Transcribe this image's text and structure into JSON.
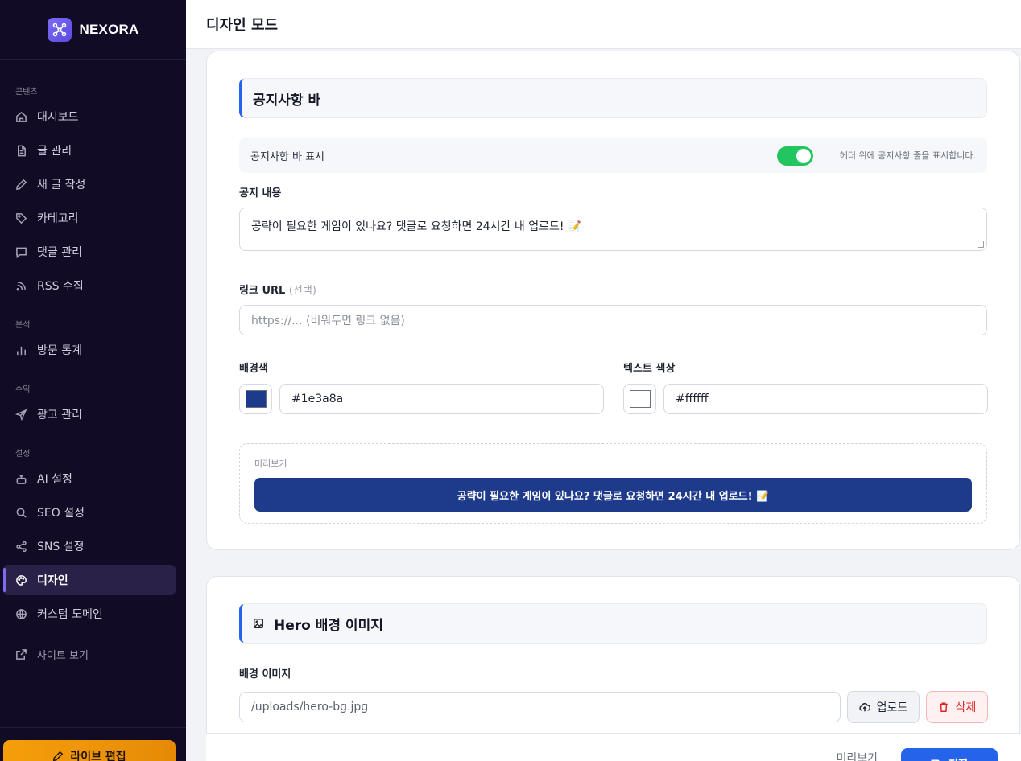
{
  "brand": {
    "name": "NEXORA",
    "logo_icon": "network-icon",
    "accent": "#7c6cf5"
  },
  "sidebar": {
    "sections": [
      {
        "label": "콘텐츠",
        "items": [
          {
            "label": "대시보드",
            "icon": "home-icon"
          },
          {
            "label": "글 관리",
            "icon": "document-icon"
          },
          {
            "label": "새 글 작성",
            "icon": "pencil-icon"
          },
          {
            "label": "카테고리",
            "icon": "tag-icon"
          },
          {
            "label": "댓글 관리",
            "icon": "comment-icon"
          },
          {
            "label": "RSS 수집",
            "icon": "rss-icon"
          }
        ]
      },
      {
        "label": "분석",
        "items": [
          {
            "label": "방문 통계",
            "icon": "bar-chart-icon"
          }
        ]
      },
      {
        "label": "수익",
        "items": [
          {
            "label": "광고 관리",
            "icon": "send-icon"
          }
        ]
      },
      {
        "label": "설정",
        "items": [
          {
            "label": "AI 설정",
            "icon": "robot-icon"
          },
          {
            "label": "SEO 설정",
            "icon": "search-icon"
          },
          {
            "label": "SNS 설정",
            "icon": "share-icon"
          },
          {
            "label": "디자인",
            "icon": "palette-icon",
            "active": true
          },
          {
            "label": "커스텀 도메인",
            "icon": "globe-icon"
          }
        ]
      }
    ],
    "site_link": {
      "label": "사이트 보기",
      "icon": "external-link-icon"
    },
    "live_edit": {
      "label": "라이브 편집",
      "icon": "edit-icon",
      "color": "#f59e0b"
    }
  },
  "header": {
    "title": "디자인 모드"
  },
  "notice_card": {
    "title": "공지사항 바",
    "toggle": {
      "label": "공지사항 바 표시",
      "on": true,
      "hint": "헤더 위에 공지사항 줄을 표시합니다.",
      "color": "#22c55e"
    },
    "content": {
      "label": "공지 내용",
      "value": "공략이 필요한 게임이 있나요? 댓글로 요청하면 24시간 내 업로드! 📝"
    },
    "link": {
      "label": "링크 URL",
      "optional": "(선택)",
      "placeholder": "https://... (비워두면 링크 없음)"
    },
    "bg_color": {
      "label": "배경색",
      "value": "#1e3a8a"
    },
    "text_color": {
      "label": "텍스트 색상",
      "value": "#ffffff"
    },
    "preview": {
      "label": "미리보기",
      "text": "공략이 필요한 게임이 있나요? 댓글로 요청하면 24시간 내 업로드! 📝"
    }
  },
  "hero_card": {
    "title": "Hero 배경 이미지",
    "title_icon": "image-icon",
    "bg_image": {
      "label": "배경 이미지",
      "value": "/uploads/hero-bg.jpg"
    },
    "upload": {
      "label": "업로드",
      "icon": "cloud-upload-icon"
    },
    "delete": {
      "label": "삭제",
      "icon": "trash-icon"
    }
  },
  "footer_bar": {
    "preview_label": "미리보기",
    "save_label": "저장",
    "save_color": "#2563eb"
  }
}
